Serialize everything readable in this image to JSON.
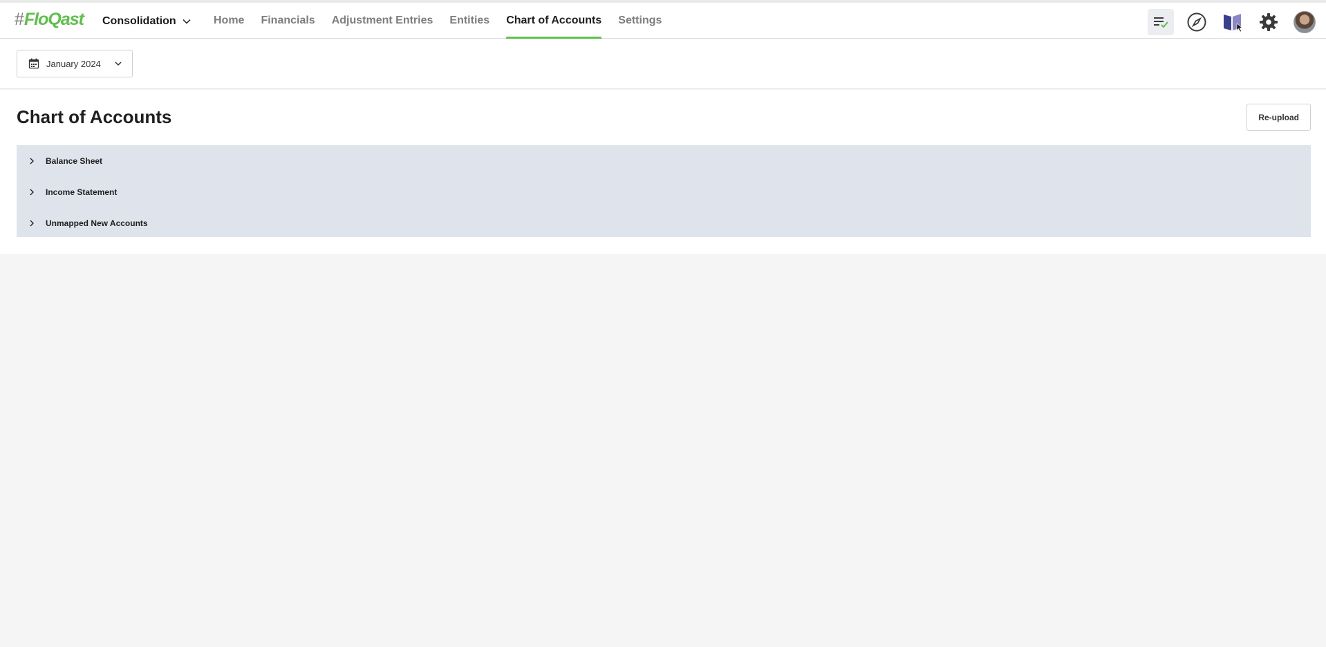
{
  "logo": {
    "hash": "#",
    "text": "FloQast"
  },
  "module": {
    "label": "Consolidation"
  },
  "nav": {
    "items": [
      {
        "label": "Home",
        "active": false
      },
      {
        "label": "Financials",
        "active": false
      },
      {
        "label": "Adjustment Entries",
        "active": false
      },
      {
        "label": "Entities",
        "active": false
      },
      {
        "label": "Chart of Accounts",
        "active": true
      },
      {
        "label": "Settings",
        "active": false
      }
    ]
  },
  "top_icons": [
    "checklist-icon",
    "compass-icon",
    "guide-book-icon",
    "gear-icon",
    "avatar"
  ],
  "date_picker": {
    "value": "January 2024"
  },
  "page": {
    "title": "Chart of Accounts",
    "reupload_label": "Re-upload"
  },
  "tree": {
    "rows": [
      {
        "label": "Balance Sheet"
      },
      {
        "label": "Income Statement"
      },
      {
        "label": "Unmapped New Accounts"
      }
    ]
  },
  "colors": {
    "accent": "#5cc04a",
    "tree_bg": "#dfe3ec",
    "page_bg": "#f5f5f5"
  }
}
